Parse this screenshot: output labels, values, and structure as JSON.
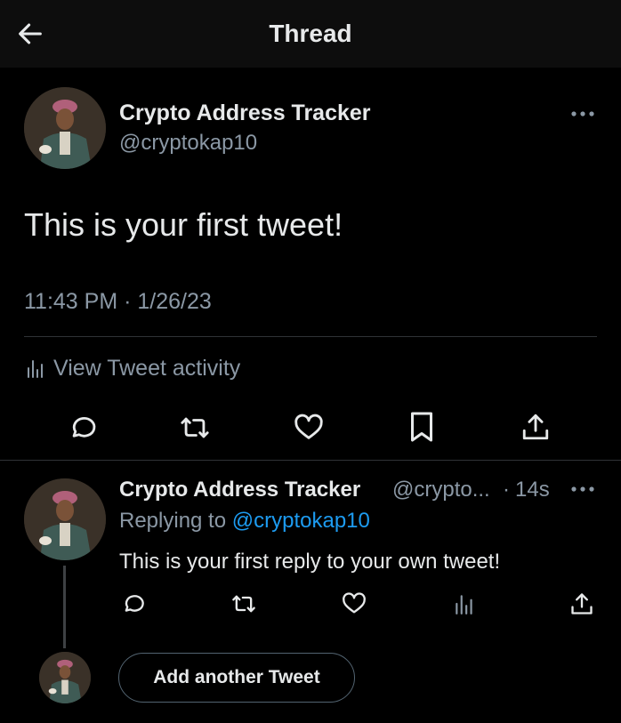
{
  "header": {
    "title": "Thread"
  },
  "tweet": {
    "display_name": "Crypto Address Tracker",
    "handle": "@cryptokap10",
    "text": "This is your first tweet!",
    "timestamp": "11:43 PM · 1/26/23",
    "activity_label": "View Tweet activity"
  },
  "reply": {
    "display_name": "Crypto Address Tracker",
    "handle_truncated": "@crypto...",
    "separator": "·",
    "age": "14s",
    "replying_prefix": "Replying to",
    "replying_handle": "@cryptokap10",
    "text": "This is your first reply to your own tweet!"
  },
  "composer": {
    "add_label": "Add another Tweet"
  },
  "icons": {
    "back": "arrow-left-icon",
    "more": "more-dots-icon",
    "reply": "reply-icon",
    "retweet": "retweet-icon",
    "like": "heart-icon",
    "bookmark": "bookmark-icon",
    "share": "share-icon",
    "analytics": "analytics-icon"
  },
  "colors": {
    "background": "#000000",
    "text": "#e7e9ea",
    "muted": "#8b98a5",
    "link": "#1d9bf0",
    "divider": "#2f3336"
  }
}
